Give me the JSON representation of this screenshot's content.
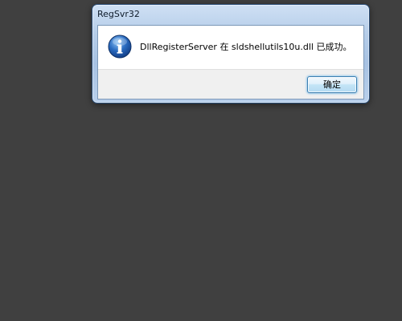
{
  "window": {
    "title": "RegSvr32"
  },
  "message": {
    "text": "DllRegisterServer 在 sldshellutils10u.dll 已成功。",
    "icon": "info-icon"
  },
  "buttons": {
    "ok_label": "确定"
  },
  "colors": {
    "desktop": "#404040",
    "title_bar": "#b5cde9",
    "message_background": "#ffffff",
    "button_bar": "#f0f0f0",
    "icon_blue": "#2a6bc0",
    "button_border": "#3c7fb1"
  }
}
